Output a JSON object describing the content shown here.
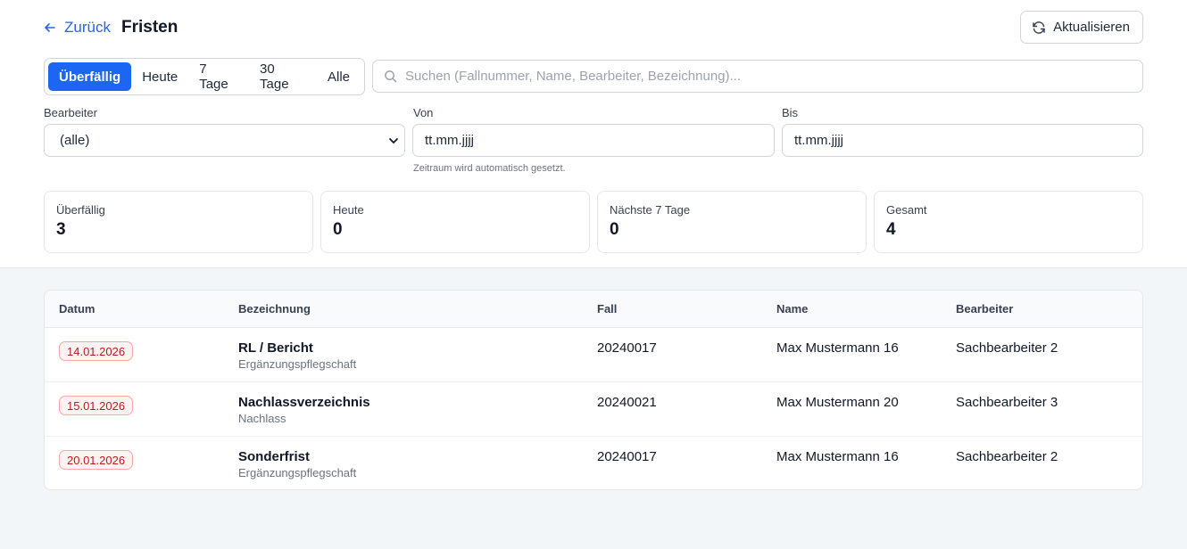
{
  "header": {
    "back_label": "Zurück",
    "title": "Fristen",
    "refresh_label": "Aktualisieren"
  },
  "filters": {
    "tabs": [
      "Überfällig",
      "Heute",
      "7 Tage",
      "30 Tage",
      "Alle"
    ],
    "active_tab": "Überfällig",
    "search_placeholder": "Suchen (Fallnummer, Name, Bearbeiter, Bezeichnung)...",
    "bearbeiter_label": "Bearbeiter",
    "bearbeiter_value": "(alle)",
    "von_label": "Von",
    "von_placeholder": "tt.mm.jjjj",
    "bis_label": "Bis",
    "bis_placeholder": "tt.mm.jjjj",
    "hint": "Zeitraum wird automatisch gesetzt."
  },
  "stats": [
    {
      "label": "Überfällig",
      "value": "3"
    },
    {
      "label": "Heute",
      "value": "0"
    },
    {
      "label": "Nächste 7 Tage",
      "value": "0"
    },
    {
      "label": "Gesamt",
      "value": "4"
    }
  ],
  "table": {
    "columns": [
      "Datum",
      "Bezeichnung",
      "Fall",
      "Name",
      "Bearbeiter"
    ],
    "rows": [
      {
        "datum": "14.01.2026",
        "bezeichnung": "RL / Bericht",
        "typ": "Ergänzungspflegschaft",
        "fall": "20240017",
        "name": "Max Mustermann 16",
        "bearbeiter": "Sachbearbeiter 2"
      },
      {
        "datum": "15.01.2026",
        "bezeichnung": "Nachlassverzeichnis",
        "typ": "Nachlass",
        "fall": "20240021",
        "name": "Max Mustermann 20",
        "bearbeiter": "Sachbearbeiter 3"
      },
      {
        "datum": "20.01.2026",
        "bezeichnung": "Sonderfrist",
        "typ": "Ergänzungspflegschaft",
        "fall": "20240017",
        "name": "Max Mustermann 16",
        "bearbeiter": "Sachbearbeiter 2"
      }
    ]
  },
  "colors": {
    "accent": "#1d66f1",
    "overdue_text": "#b91c1c",
    "overdue_border": "#fca5a5"
  }
}
